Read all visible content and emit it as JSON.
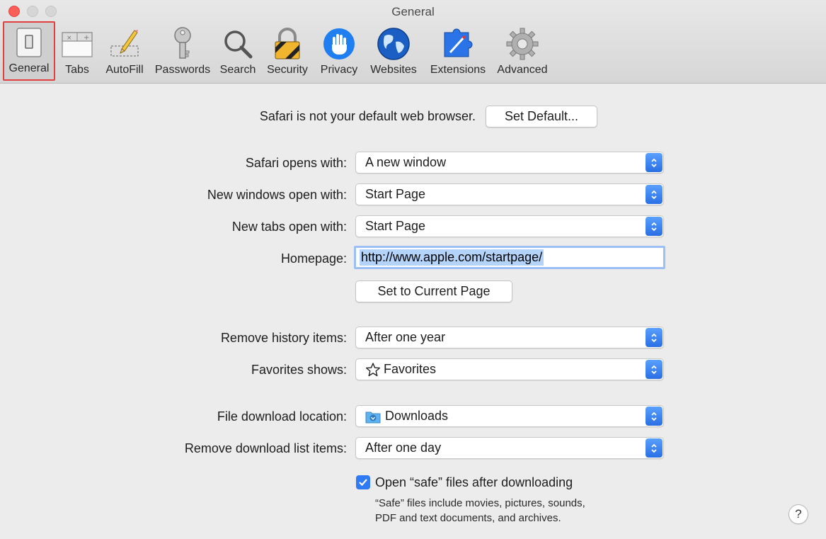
{
  "window": {
    "title": "General"
  },
  "toolbar": {
    "items": [
      {
        "label": "General",
        "icon": "general-switch-icon",
        "selected": true
      },
      {
        "label": "Tabs",
        "icon": "tabs-icon"
      },
      {
        "label": "AutoFill",
        "icon": "pencil-form-icon"
      },
      {
        "label": "Passwords",
        "icon": "key-icon"
      },
      {
        "label": "Search",
        "icon": "magnifier-icon"
      },
      {
        "label": "Security",
        "icon": "padlock-icon"
      },
      {
        "label": "Privacy",
        "icon": "hand-icon"
      },
      {
        "label": "Websites",
        "icon": "globe-icon"
      },
      {
        "label": "Extensions",
        "icon": "puzzle-compass-icon"
      },
      {
        "label": "Advanced",
        "icon": "gear-icon"
      }
    ]
  },
  "default_browser": {
    "message": "Safari is not your default web browser.",
    "button": "Set Default..."
  },
  "settings": {
    "opens_with": {
      "label": "Safari opens with:",
      "value": "A new window"
    },
    "new_windows": {
      "label": "New windows open with:",
      "value": "Start Page"
    },
    "new_tabs": {
      "label": "New tabs open with:",
      "value": "Start Page"
    },
    "homepage": {
      "label": "Homepage:",
      "value": "http://www.apple.com/startpage/"
    },
    "set_current": {
      "button": "Set to Current Page"
    },
    "remove_history": {
      "label": "Remove history items:",
      "value": "After one year"
    },
    "favorites_shows": {
      "label": "Favorites shows:",
      "value": "Favorites",
      "icon": "star-outline-icon"
    },
    "download_location": {
      "label": "File download location:",
      "value": "Downloads",
      "icon": "downloads-folder-icon"
    },
    "remove_downloads": {
      "label": "Remove download list items:",
      "value": "After one day"
    },
    "open_safe": {
      "label": "Open “safe” files after downloading",
      "checked": true,
      "note_line1": "“Safe” files include movies, pictures, sounds,",
      "note_line2": "PDF and text documents, and archives."
    }
  },
  "help": {
    "label": "?"
  },
  "colors": {
    "accent": "#2f7bf5",
    "selection": "#b3d3fb",
    "close": "#fc5f57"
  }
}
